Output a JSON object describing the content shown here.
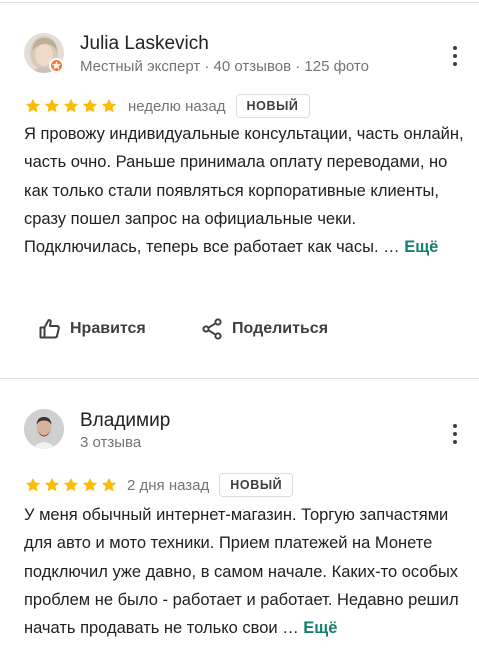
{
  "colors": {
    "star": "#fbbc04",
    "link": "#137f6e",
    "meta": "#70757a"
  },
  "reviews": [
    {
      "author": "Julia Laskevich",
      "meta": "Местный эксперт · 40 отзывов · 125 фото",
      "rating": 5,
      "date": "неделю назад",
      "badge": "НОВЫЙ",
      "text": "Я провожу индивидуальные консультации, часть онлайн, часть очно. Раньше принимала оплату переводами, но как только стали появляться корпоративные клиенты, сразу пошел запрос на официальные чеки. Подключилась, теперь все работает как часы. …",
      "more": "Ещё",
      "actions": {
        "like": "Нравится",
        "share": "Поделиться"
      }
    },
    {
      "author": "Владимир",
      "meta": "3 отзыва",
      "rating": 5,
      "date": "2 дня назад",
      "badge": "НОВЫЙ",
      "text": "У меня обычный интернет-магазин. Торгую запчастями для авто и мото техники. Прием платежей на Монете подключил уже давно, в самом начале. Каких-то особых проблем не было - работает и работает. Недавно решил начать продавать не только свои …",
      "more": "Ещё"
    }
  ],
  "icons": {
    "kebab": "more-vert-icon",
    "like": "thumb-up-icon",
    "share": "share-icon",
    "star": "star-icon",
    "guide": "local-guide-badge-icon"
  }
}
